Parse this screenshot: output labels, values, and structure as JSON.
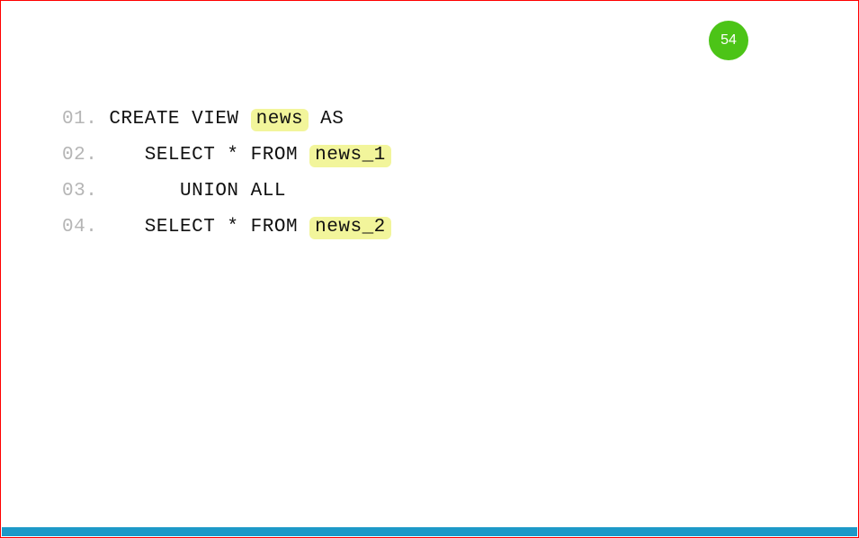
{
  "page_number": "54",
  "code": {
    "lines": [
      {
        "no": "01.",
        "prefix": " CREATE VIEW ",
        "highlight": "news",
        "suffix": " AS"
      },
      {
        "no": "02.",
        "prefix": "    SELECT * FROM ",
        "highlight": "news_1",
        "suffix": ""
      },
      {
        "no": "03.",
        "prefix": "       UNION ALL",
        "highlight": "",
        "suffix": ""
      },
      {
        "no": "04.",
        "prefix": "    SELECT * FROM ",
        "highlight": "news_2",
        "suffix": ""
      }
    ]
  }
}
